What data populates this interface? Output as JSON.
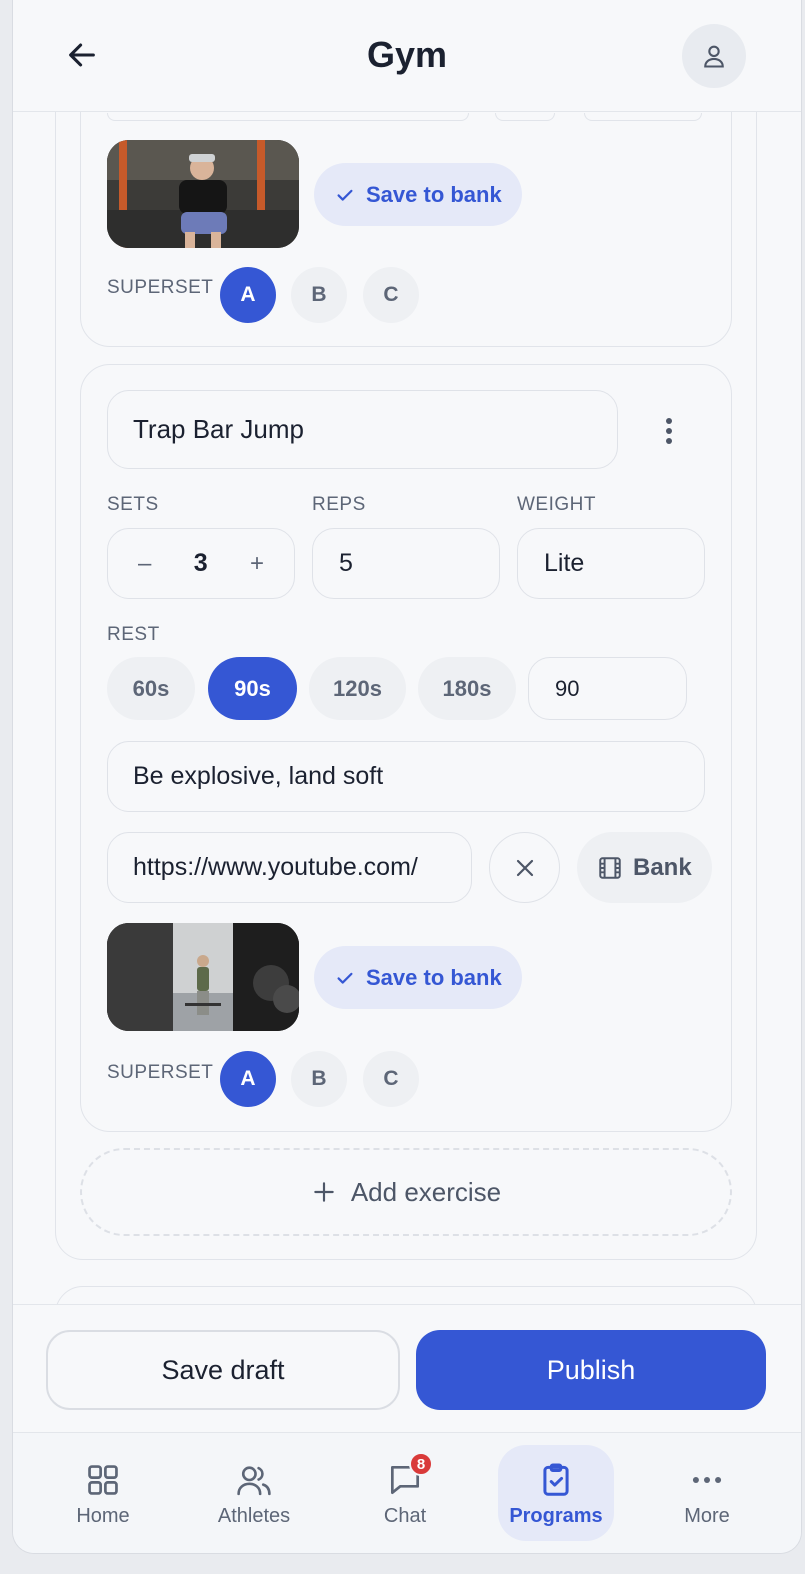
{
  "header": {
    "title": "Gym"
  },
  "exercise_previous": {
    "save_to_bank_label": "Save to bank",
    "superset_label": "SUPERSET",
    "superset_options": [
      "A",
      "B",
      "C"
    ],
    "superset_selected": "A"
  },
  "exercise": {
    "name": "Trap Bar Jump",
    "sets_label": "SETS",
    "reps_label": "REPS",
    "weight_label": "WEIGHT",
    "sets_value": "3",
    "sets_minus": "–",
    "sets_plus": "+",
    "reps_value": "5",
    "weight_value": "Lite",
    "rest_label": "REST",
    "rest_options": [
      "60s",
      "90s",
      "120s",
      "180s"
    ],
    "rest_selected": "90s",
    "rest_custom_value": "90",
    "notes_value": "Be explosive, land soft",
    "video_url": "https://www.youtube.com/",
    "bank_label": "Bank",
    "save_to_bank_label": "Save to bank",
    "superset_label": "SUPERSET",
    "superset_options": [
      "A",
      "B",
      "C"
    ],
    "superset_selected": "A"
  },
  "add_exercise_label": "Add exercise",
  "actions": {
    "save_draft_label": "Save draft",
    "publish_label": "Publish"
  },
  "tabbar": {
    "items": [
      {
        "label": "Home",
        "icon": "grid-icon"
      },
      {
        "label": "Athletes",
        "icon": "users-icon"
      },
      {
        "label": "Chat",
        "icon": "chat-icon",
        "badge": "8"
      },
      {
        "label": "Programs",
        "icon": "clipboard-check-icon",
        "active": true
      },
      {
        "label": "More",
        "icon": "more-dots-icon"
      }
    ]
  },
  "colors": {
    "accent": "#3557d4",
    "accent_soft": "#e5e9f8",
    "badge": "#d93a3a",
    "background": "#f7f8fa"
  }
}
